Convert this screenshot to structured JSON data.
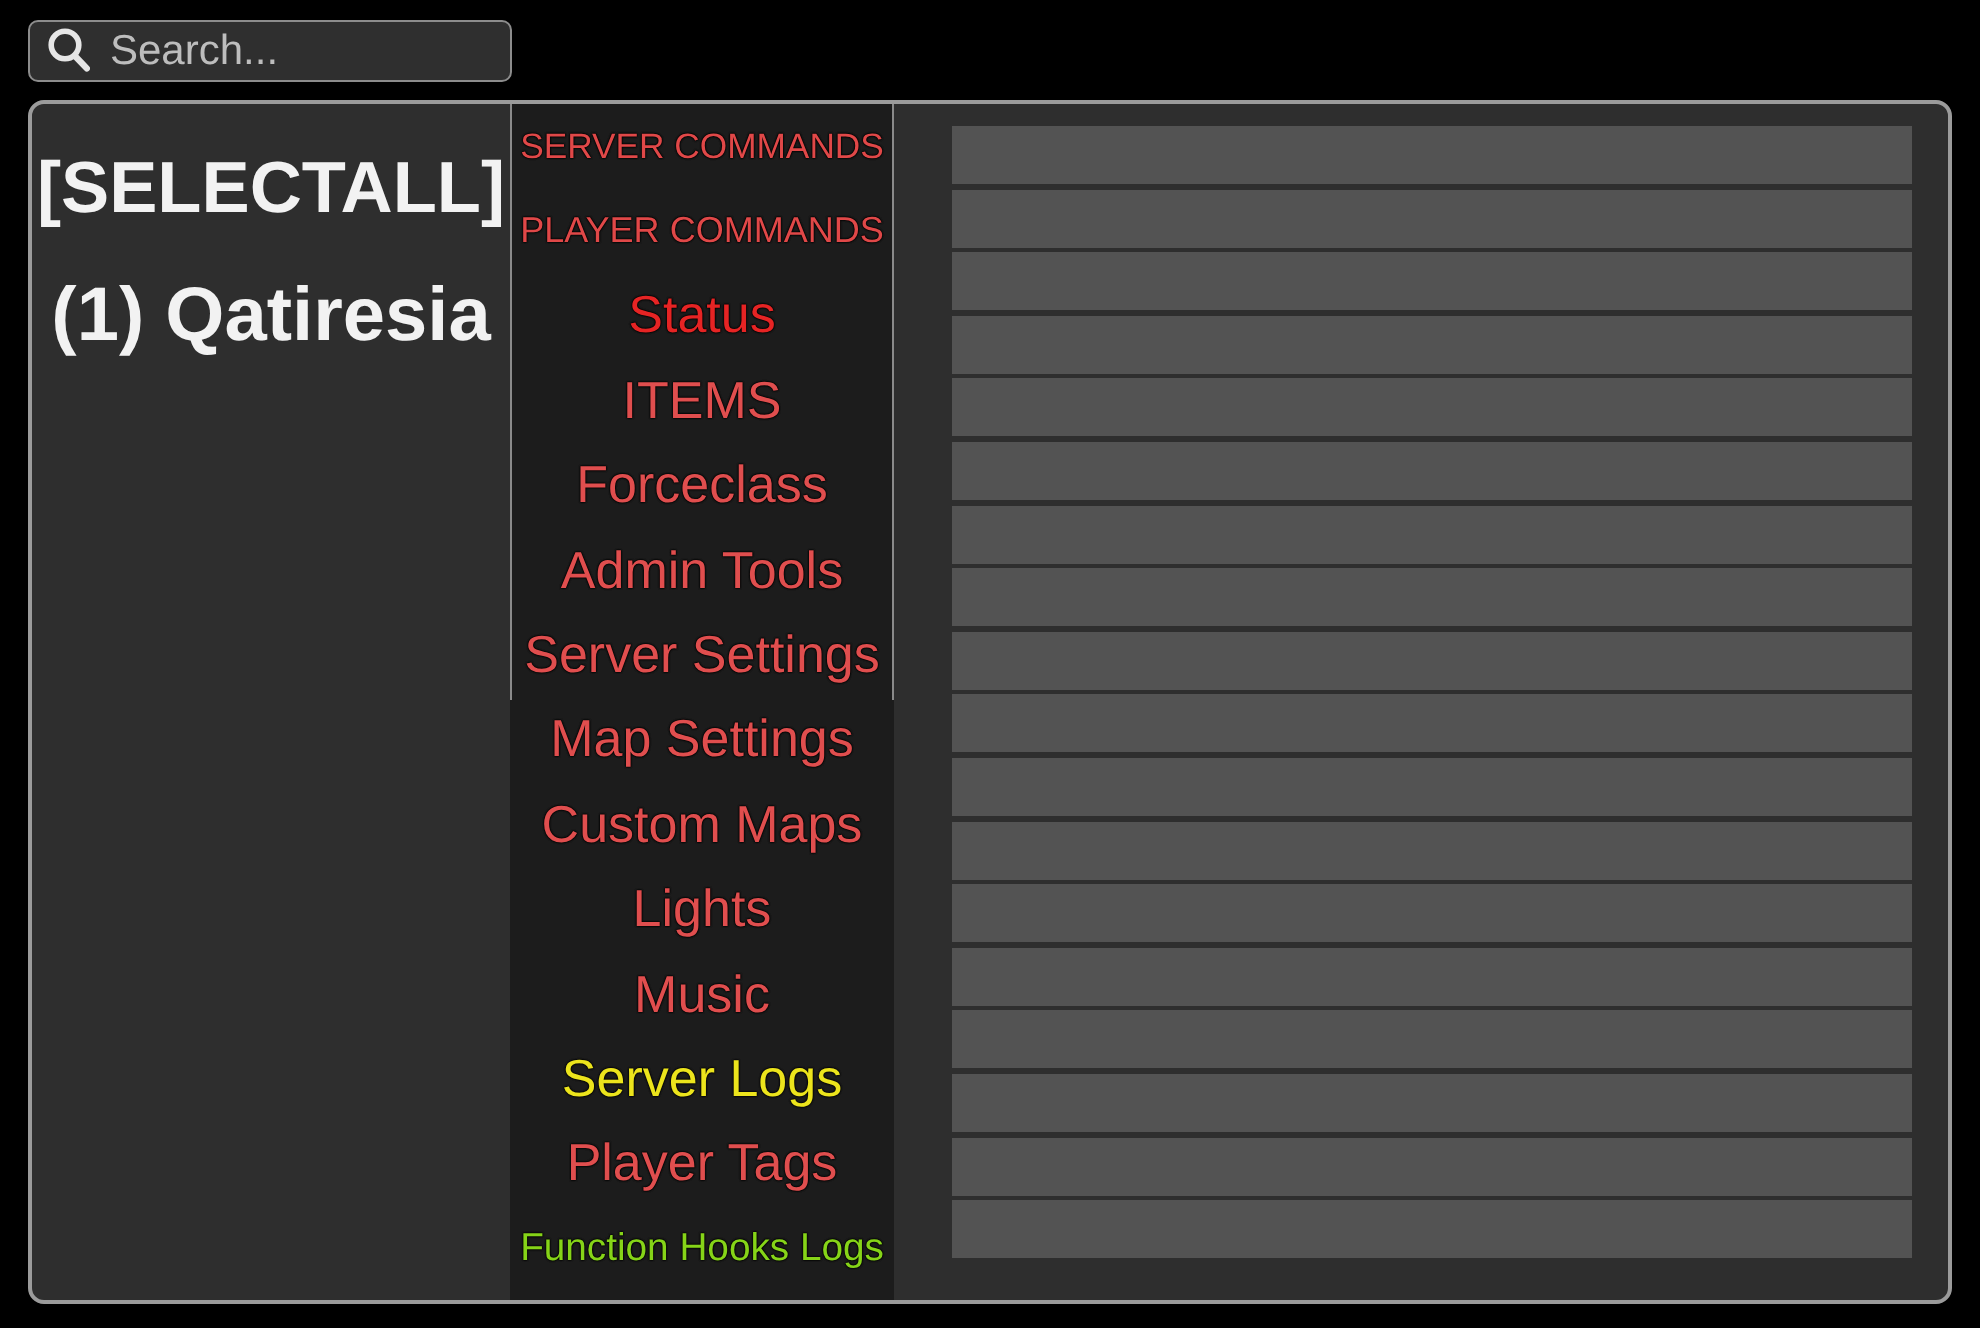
{
  "search": {
    "placeholder": "Search..."
  },
  "players": [
    {
      "label": "[SELECTALL]"
    },
    {
      "label": "(1) Qatiresia"
    }
  ],
  "commands": [
    {
      "label": "SERVER COMMANDS",
      "color": "#e04848"
    },
    {
      "label": "PLAYER COMMANDS",
      "color": "#e04848"
    },
    {
      "label": "Status",
      "color": "#e62424"
    },
    {
      "label": "ITEMS",
      "color": "#e04e4e"
    },
    {
      "label": "Forceclass",
      "color": "#e04e4e"
    },
    {
      "label": "Admin Tools",
      "color": "#e04e4e"
    },
    {
      "label": "Server Settings",
      "color": "#e04e4e"
    },
    {
      "label": "Map Settings",
      "color": "#e04e4e"
    },
    {
      "label": "Custom Maps",
      "color": "#e04e4e"
    },
    {
      "label": "Lights",
      "color": "#e04e4e"
    },
    {
      "label": "Music",
      "color": "#e04e4e"
    },
    {
      "label": "Server Logs",
      "color": "#ece41c"
    },
    {
      "label": "Player Tags",
      "color": "#e04e4e"
    },
    {
      "label": "Function Hooks Logs",
      "color": "#86d418"
    }
  ]
}
